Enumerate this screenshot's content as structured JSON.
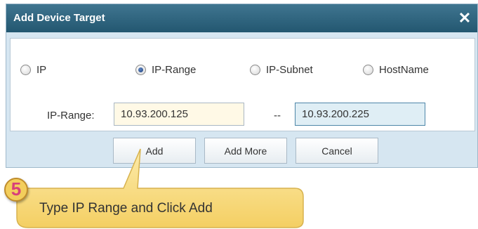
{
  "dialog": {
    "title": "Add Device Target",
    "close_glyph": "✕"
  },
  "target_type": {
    "options": [
      {
        "label": "IP",
        "checked": false
      },
      {
        "label": "IP-Range",
        "checked": true
      },
      {
        "label": "IP-Subnet",
        "checked": false
      },
      {
        "label": "HostName",
        "checked": false
      }
    ]
  },
  "range": {
    "label": "IP-Range:",
    "start_value": "10.93.200.125",
    "separator": "--",
    "end_value": "10.93.200.225"
  },
  "buttons": {
    "add": "Add",
    "add_more": "Add More",
    "cancel": "Cancel"
  },
  "callout": {
    "step_number": "5",
    "text": "Type IP Range and Click Add"
  },
  "colors": {
    "titlebar": "#235770",
    "dialog_background": "#d6e6f1",
    "callout_fill": "#f9df83",
    "step_badge": "#f3ce5c",
    "step_number": "#d8407a"
  }
}
